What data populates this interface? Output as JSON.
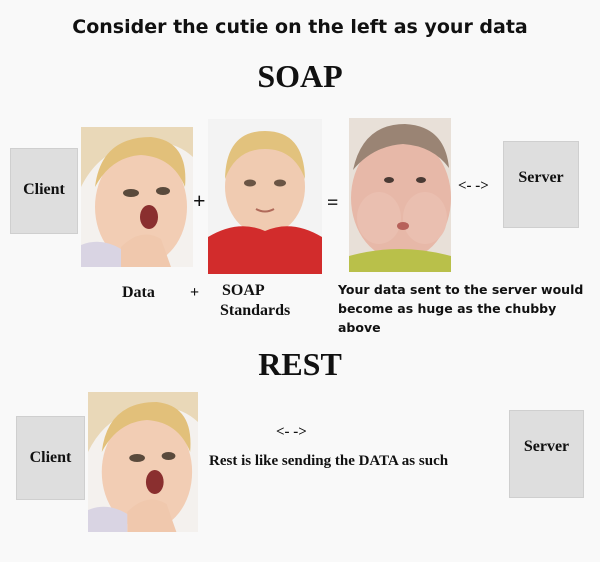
{
  "title": "Consider the cutie on the left as your data",
  "soap": {
    "heading": "SOAP",
    "client": "Client",
    "server": "Server",
    "plus": "+",
    "equals": "=",
    "arrow": "<- ->",
    "label_data": "Data",
    "label_plus": "+",
    "label_soap": "SOAP",
    "label_standards": "Standards",
    "note_line1": "Your data sent to the server would",
    "note_line2": "become as huge as the chubby above"
  },
  "rest": {
    "heading": "REST",
    "client": "Client",
    "server": "Server",
    "arrow": "<- ->",
    "caption": "Rest is like sending the DATA as such"
  }
}
